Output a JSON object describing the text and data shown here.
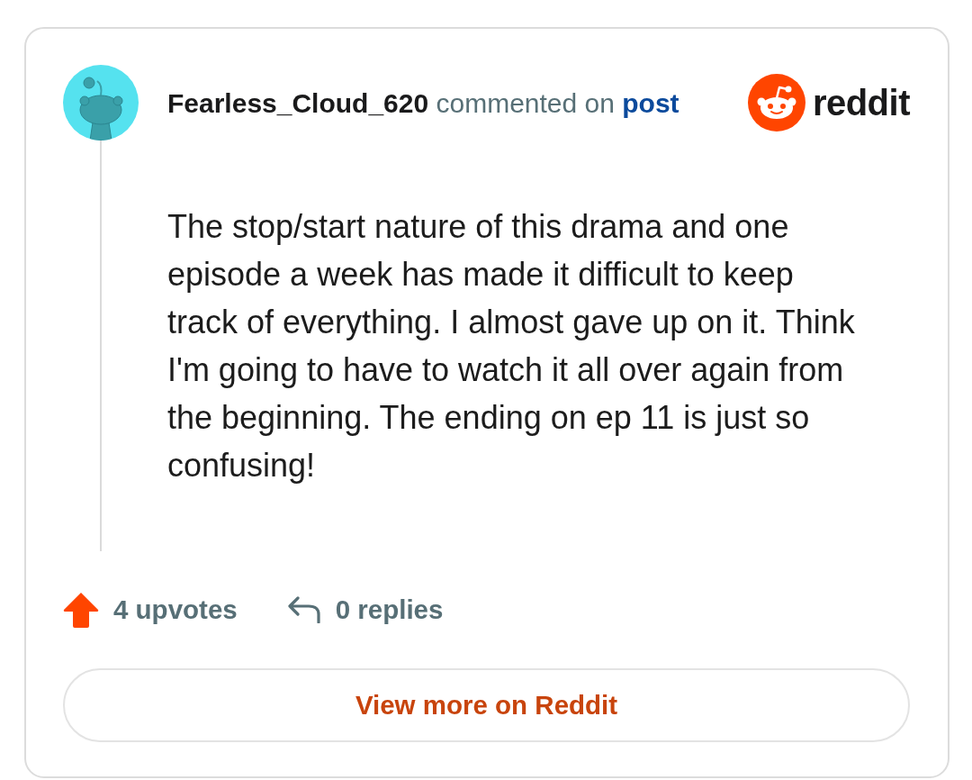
{
  "author": {
    "username": "Fearless_Cloud_620",
    "action": "commented on",
    "target": "post"
  },
  "logo": {
    "wordmark": "reddit"
  },
  "comment": {
    "text": "The stop/start nature of this drama and one episode a week has made it difficult to keep track of everything. I almost gave up on it. Think I'm going to have to watch it all over again from the beginning. The ending on ep 11 is just so confusing!"
  },
  "stats": {
    "upvotes": "4 upvotes",
    "replies": "0 replies"
  },
  "button": {
    "label": "View more on Reddit"
  }
}
